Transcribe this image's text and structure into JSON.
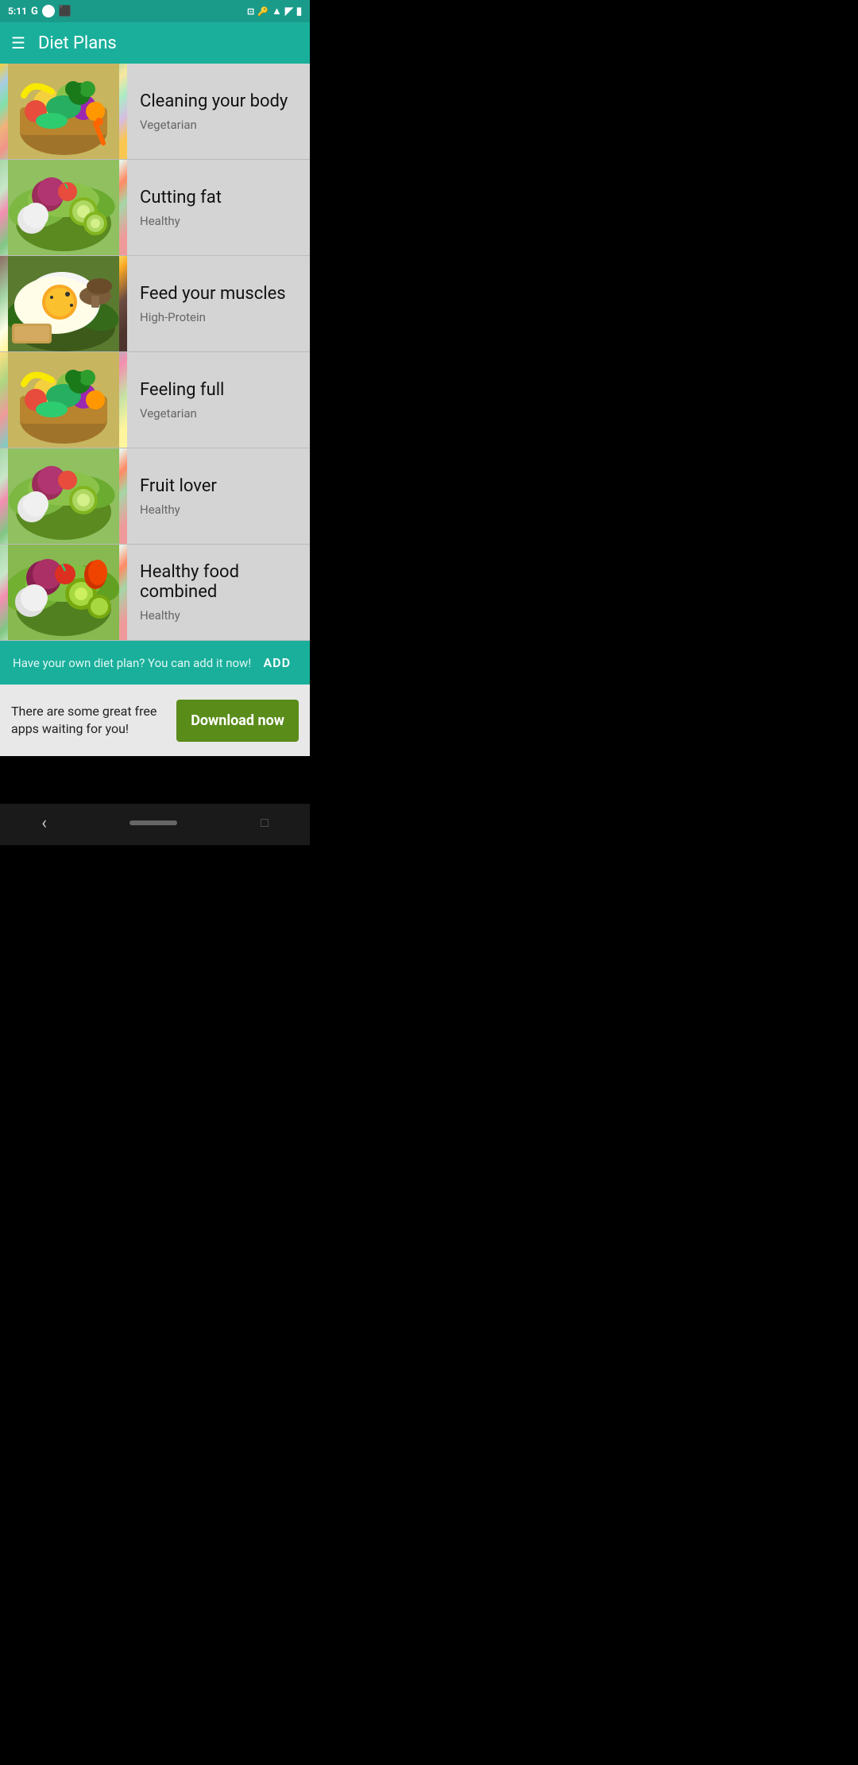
{
  "status_bar": {
    "time": "5:11",
    "icons_left": [
      "G",
      "●",
      "⬛"
    ],
    "icons_right": [
      "⊠",
      "🔑",
      "▲",
      "📶",
      "🔋"
    ]
  },
  "toolbar": {
    "menu_icon": "☰",
    "title": "Diet Plans"
  },
  "diet_items": [
    {
      "id": "cleaning-your-body",
      "name": "Cleaning your body",
      "category": "Vegetarian",
      "image_type": "veggies",
      "emoji": "🥦"
    },
    {
      "id": "cutting-fat",
      "name": "Cutting fat",
      "category": "Healthy",
      "image_type": "salad",
      "emoji": "🥗"
    },
    {
      "id": "feed-your-muscles",
      "name": "Feed your muscles",
      "category": "High-Protein",
      "image_type": "egg",
      "emoji": "🍳"
    },
    {
      "id": "feeling-full",
      "name": "Feeling full",
      "category": "Vegetarian",
      "image_type": "veggies",
      "emoji": "🥑"
    },
    {
      "id": "fruit-lover",
      "name": "Fruit lover",
      "category": "Healthy",
      "image_type": "salad",
      "emoji": "🥬"
    },
    {
      "id": "healthy-food-combined",
      "name": "Healthy food combined",
      "category": "Healthy",
      "image_type": "salad2",
      "emoji": "🥗"
    }
  ],
  "add_plan_banner": {
    "text": "Have your own diet plan? You can add it now!",
    "button_label": "Add"
  },
  "ad_banner": {
    "text": "There are some great free apps waiting for you!",
    "button_label": "Download now"
  },
  "nav_bar": {
    "back_icon": "‹",
    "home_pill": "",
    "recents": "□"
  }
}
